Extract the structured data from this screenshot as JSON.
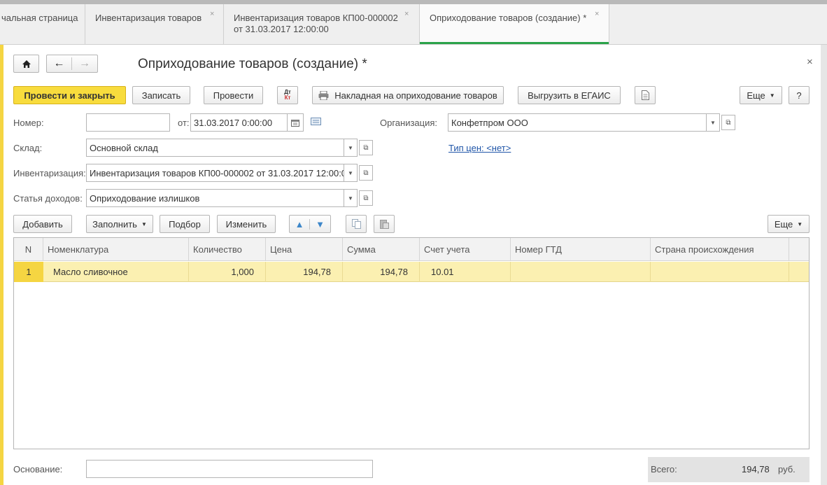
{
  "tabs": [
    {
      "label": "чальная страница"
    },
    {
      "label": "Инвентаризация товаров",
      "close": "×"
    },
    {
      "label_line1": "Инвентаризация товаров КП00-000002",
      "label_line2": "от 31.03.2017 12:00:00",
      "close": "×"
    },
    {
      "label": "Оприходование товаров (создание) *",
      "close": "×"
    }
  ],
  "nav": {
    "home_icon": "home-icon",
    "back_icon": "arrow-left-icon",
    "forward_icon": "arrow-right-icon"
  },
  "form_title": "Оприходование товаров (создание) *",
  "close_icon": "×",
  "toolbar": {
    "post_close": "Провести и закрыть",
    "save": "Записать",
    "post": "Провести",
    "dtkt_top": "Дт",
    "dtkt_bottom": "Кт",
    "print_invoice": "Накладная на оприходование товаров",
    "upload_egais": "Выгрузить в ЕГАИС",
    "more": "Еще",
    "help": "?"
  },
  "fields": {
    "number_label": "Номер:",
    "number_value": "",
    "date_label": "от:",
    "date_value": "31.03.2017  0:00:00",
    "org_label": "Организация:",
    "org_value": "Конфетпром ООО",
    "warehouse_label": "Склад:",
    "warehouse_value": "Основной склад",
    "price_type_link": "Тип цен: <нет>",
    "inventory_label": "Инвентаризация:",
    "inventory_value": "Инвентаризация товаров КП00-000002 от 31.03.2017 12:00:0",
    "income_label": "Статья доходов:",
    "income_value": "Оприходование излишков"
  },
  "table_toolbar": {
    "add": "Добавить",
    "fill": "Заполнить",
    "selection": "Подбор",
    "edit": "Изменить",
    "more": "Еще"
  },
  "table": {
    "columns": [
      "N",
      "Номенклатура",
      "Количество",
      "Цена",
      "Сумма",
      "Счет учета",
      "Номер ГТД",
      "Страна происхождения"
    ],
    "rows": [
      {
        "n": "1",
        "item": "Масло сливочное",
        "qty": "1,000",
        "price": "194,78",
        "sum": "194,78",
        "account": "10.01",
        "gtd": "",
        "country": ""
      }
    ]
  },
  "footer": {
    "basis_label": "Основание:",
    "basis_value": "",
    "total_label": "Всего:",
    "total_value": "194,78",
    "currency": "руб."
  },
  "colors": {
    "accent": "#f8dc3d",
    "active_tab_line": "#2ba34a",
    "row_highlight": "#fbf0b1",
    "link": "#1f55a8"
  }
}
